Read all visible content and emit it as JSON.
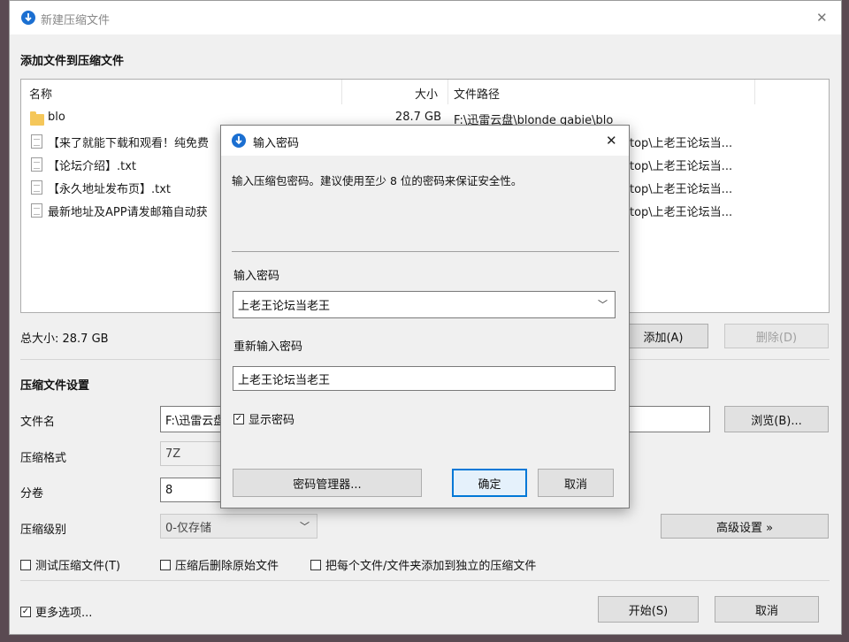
{
  "main_window": {
    "title": "新建压缩文件",
    "section_add": "添加文件到压缩文件",
    "columns": {
      "name": "名称",
      "size": "大小",
      "path": "文件路径"
    },
    "files": [
      {
        "name": "blo",
        "size": "28.7 GB",
        "path": "F:\\迅雷云盘\\blonde gabie\\blo",
        "type": "folder"
      },
      {
        "name": "【来了就能下载和观看！纯免费",
        "size": "",
        "path": "top\\上老王论坛当...",
        "type": "file"
      },
      {
        "name": "【论坛介绍】.txt",
        "size": "",
        "path": "top\\上老王论坛当...",
        "type": "file"
      },
      {
        "name": "【永久地址发布页】.txt",
        "size": "",
        "path": "top\\上老王论坛当...",
        "type": "file"
      },
      {
        "name": "最新地址及APP请发邮箱自动获",
        "size": "",
        "path": "top\\上老王论坛当...",
        "type": "file"
      }
    ],
    "total_size": "总大小: 28.7 GB",
    "add_button": "添加(A)",
    "delete_button": "删除(D)",
    "settings_title": "压缩文件设置",
    "filename_label": "文件名",
    "filename_value": "F:\\迅雷云盘",
    "browse_button": "浏览(B)...",
    "format_label": "压缩格式",
    "format_value": "7Z",
    "split_label": "分卷",
    "split_value": "8",
    "level_label": "压缩级别",
    "level_value": "0-仅存储",
    "advanced_button": "高级设置 »",
    "opt_test": "测试压缩文件(T)",
    "opt_delete": "压缩后删除原始文件",
    "opt_each": "把每个文件/文件夹添加到独立的压缩文件",
    "more_options": "更多选项...",
    "start_button": "开始(S)",
    "cancel_button": "取消",
    "close_glyph": "✕"
  },
  "dialog": {
    "title": "输入密码",
    "description": "输入压缩包密码。建议使用至少 8 位的密码来保证安全性。",
    "password_label": "输入密码",
    "password_value": "上老王论坛当老王",
    "confirm_label": "重新输入密码",
    "confirm_value": "上老王论坛当老王",
    "show_password": "显示密码",
    "show_password_checked": true,
    "manager_button": "密码管理器...",
    "ok_button": "确定",
    "cancel_button": "取消",
    "close_glyph": "✕"
  },
  "colors": {
    "accent": "#0078d7",
    "window_bg": "#f0f0f0",
    "list_bg": "#ffffff",
    "app_icon": "#1b6fd1"
  }
}
